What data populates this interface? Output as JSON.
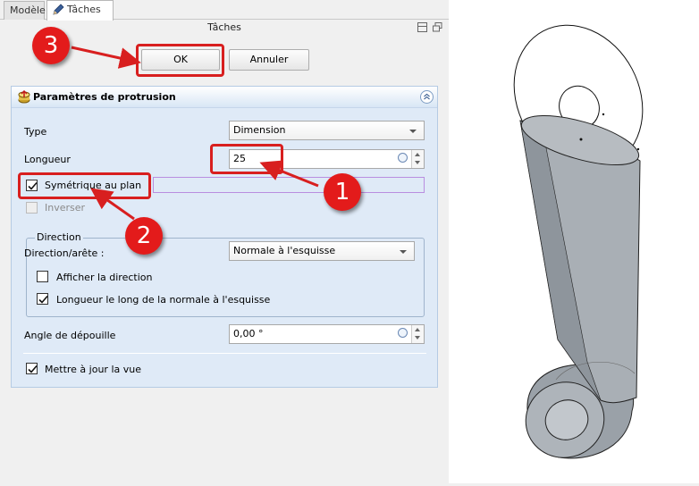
{
  "tabs": [
    {
      "label": "Modèle",
      "active": false
    },
    {
      "label": "Tâches",
      "active": true
    }
  ],
  "tasks_title": "Tâches",
  "buttons": {
    "ok": "OK",
    "cancel": "Annuler"
  },
  "panel": {
    "title": "Paramètres de protrusion",
    "type_label": "Type",
    "type_value": "Dimension",
    "length_label": "Longueur",
    "length_value": "25",
    "symmetric_label": "Symétrique au plan",
    "symmetric_checked": true,
    "reversed_label": "Inverser",
    "reversed_checked": false,
    "direction_group": "Direction",
    "direction_edge_label": "Direction/arête :",
    "direction_edge_value": "Normale à l'esquisse",
    "show_direction_label": "Afficher la direction",
    "show_direction_checked": false,
    "length_along_normal_label": "Longueur le long de la normale à l'esquisse",
    "length_along_normal_checked": true,
    "draft_angle_label": "Angle de dépouille",
    "draft_angle_value": "0,00 °",
    "update_view_label": "Mettre à jour la vue",
    "update_view_checked": true
  },
  "annotations": [
    {
      "number": "1",
      "color": "#e31b1b"
    },
    {
      "number": "2",
      "color": "#e31b1b"
    },
    {
      "number": "3",
      "color": "#e31b1b"
    }
  ],
  "icons": [
    "pencil-icon",
    "pad-icon",
    "collapse-icon",
    "expression-icon"
  ],
  "colors": {
    "panel_bg": "#dfeaf7",
    "annotation_red": "#e31b1b",
    "model_gray": "#a9afb5"
  }
}
